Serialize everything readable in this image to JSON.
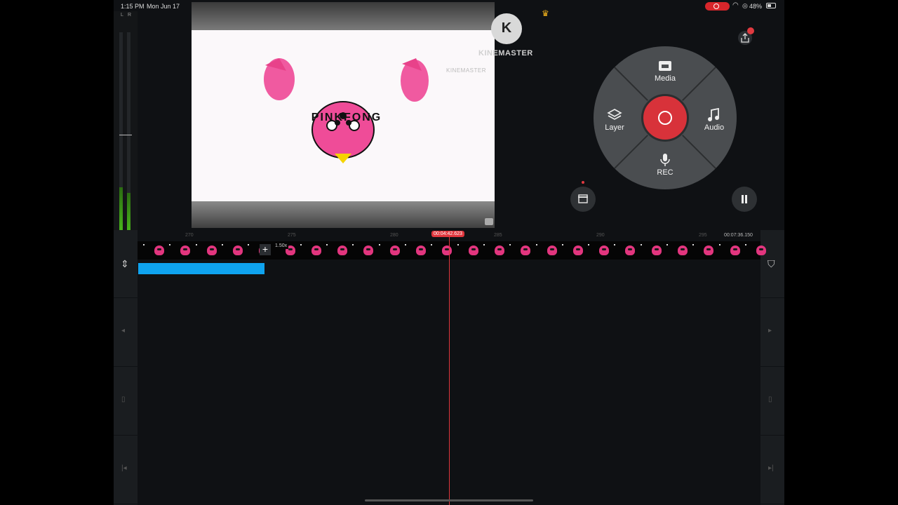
{
  "status_bar": {
    "time": "1:15 PM",
    "date": "Mon Jun 17",
    "battery": "48%"
  },
  "meter": {
    "left_label": "L",
    "right_label": "R",
    "left_level": 0.25,
    "right_level": 0.22
  },
  "preview": {
    "logo_text": "KINEMASTER",
    "logo_letter": "K",
    "watermark_small": "KINEMASTER",
    "title_text": "PINKFONG"
  },
  "menu": {
    "media_label": "Media",
    "layer_label": "Layer",
    "audio_label": "Audio",
    "rec_label": "REC"
  },
  "timeline": {
    "current_time": "00:04:42.623",
    "total_time": "00:07:36.150",
    "speed_label": "1.50x",
    "ruler_ticks": [
      "270",
      "275",
      "280",
      "285",
      "290",
      "295"
    ]
  },
  "colors": {
    "accent": "#d8323a",
    "audio_clip": "#0fa3ef",
    "panel": "#0f1114",
    "wheel": "#4a4d50"
  }
}
